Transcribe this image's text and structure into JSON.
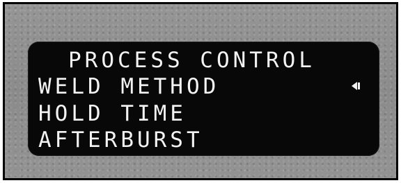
{
  "screen": {
    "title": "PROCESS CONTROL",
    "menu_items": [
      {
        "label": "WELD METHOD",
        "selected": true
      },
      {
        "label": "HOLD TIME",
        "selected": false
      },
      {
        "label": "AFTERBURST",
        "selected": false
      }
    ],
    "cursor_icon": "left-arrow-cursor-icon"
  },
  "colors": {
    "screen_background": "#080808",
    "text": "#f3f3f3",
    "bezel": "#8f8f8f"
  }
}
